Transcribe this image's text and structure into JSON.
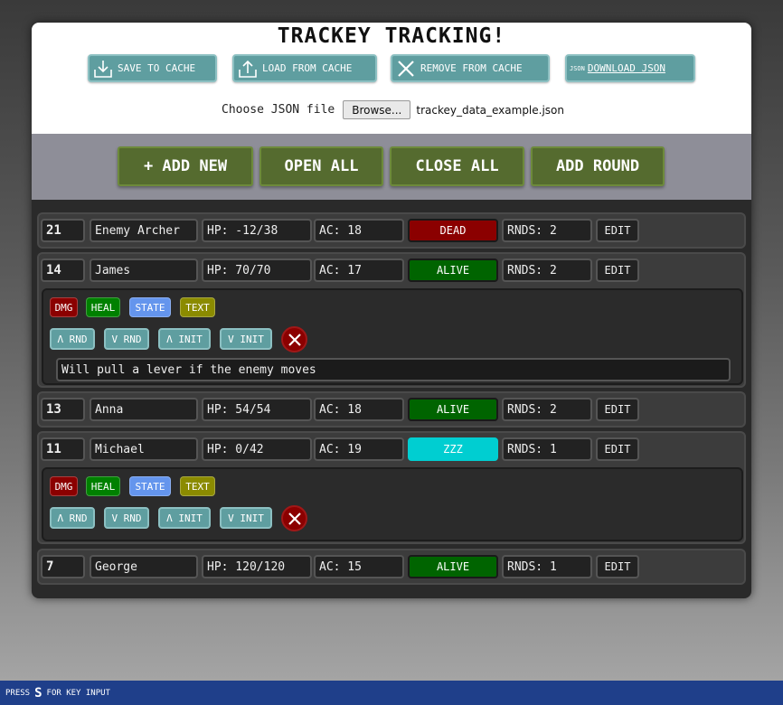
{
  "app": {
    "title": "TRACKEY TRACKING!"
  },
  "cache_buttons": {
    "save": "SAVE TO CACHE",
    "load": "LOAD FROM CACHE",
    "remove": "REMOVE FROM CACHE",
    "download": "DOWNLOAD JSON",
    "download_icon_text": "JSON"
  },
  "file": {
    "label": "Choose JSON file",
    "browse": "Browse...",
    "filename": "trackey_data_example.json"
  },
  "actions": {
    "add_new": "+ ADD NEW",
    "open_all": "OPEN ALL",
    "close_all": "CLOSE ALL",
    "add_round": "ADD ROUND"
  },
  "entries": [
    {
      "initiative": "21",
      "name": "Enemy Archer",
      "hp": "HP: -12/38",
      "ac": "AC: 18",
      "status": "DEAD",
      "status_color": "#8b0000",
      "rounds": "RNDS: 2",
      "edit": "EDIT"
    },
    {
      "initiative": "14",
      "name": "James",
      "hp": "HP: 70/70",
      "ac": "AC: 17",
      "status": "ALIVE",
      "status_color": "#006400",
      "rounds": "RNDS: 2",
      "edit": "EDIT",
      "note": "Will pull a lever if the enemy moves"
    },
    {
      "initiative": "13",
      "name": "Anna",
      "hp": "HP: 54/54",
      "ac": "AC: 18",
      "status": "ALIVE",
      "status_color": "#006400",
      "rounds": "RNDS: 2",
      "edit": "EDIT"
    },
    {
      "initiative": "11",
      "name": "Michael",
      "hp": "HP: 0/42",
      "ac": "AC: 19",
      "status": "ZZZ",
      "status_color": "#00ced1",
      "rounds": "RNDS: 1",
      "edit": "EDIT"
    },
    {
      "initiative": "7",
      "name": "George",
      "hp": "HP: 120/120",
      "ac": "AC: 15",
      "status": "ALIVE",
      "status_color": "#006400",
      "rounds": "RNDS: 1",
      "edit": "EDIT"
    }
  ],
  "detail_controls": {
    "dmg": "DMG",
    "heal": "HEAL",
    "state": "STATE",
    "text": "TEXT",
    "rnd_up": "Λ RND",
    "rnd_down": "V RND",
    "init_up": "Λ INIT",
    "init_down": "V INIT"
  },
  "colors": {
    "dmg": "#8b0000",
    "heal": "#008000",
    "state": "#6495ed",
    "text": "#8b8b00",
    "teal": "#5f9ea0",
    "olive": "#556b2f"
  },
  "footer": {
    "prefix": "PRESS",
    "key": "S",
    "suffix": "FOR KEY INPUT"
  }
}
